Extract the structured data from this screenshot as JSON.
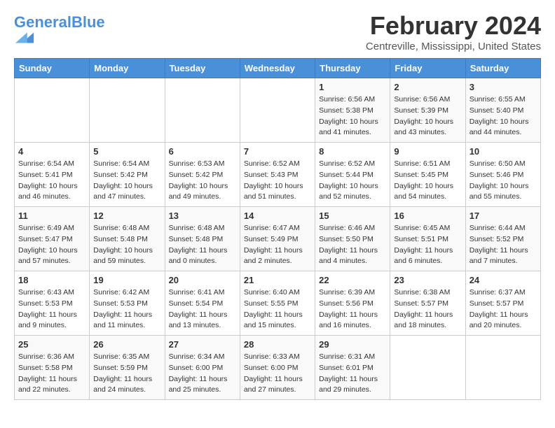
{
  "header": {
    "logo_text_general": "General",
    "logo_text_blue": "Blue",
    "month_year": "February 2024",
    "location": "Centreville, Mississippi, United States"
  },
  "days_of_week": [
    "Sunday",
    "Monday",
    "Tuesday",
    "Wednesday",
    "Thursday",
    "Friday",
    "Saturday"
  ],
  "weeks": [
    [
      {
        "day": "",
        "sunrise": "",
        "sunset": "",
        "daylight": ""
      },
      {
        "day": "",
        "sunrise": "",
        "sunset": "",
        "daylight": ""
      },
      {
        "day": "",
        "sunrise": "",
        "sunset": "",
        "daylight": ""
      },
      {
        "day": "",
        "sunrise": "",
        "sunset": "",
        "daylight": ""
      },
      {
        "day": "1",
        "sunrise": "Sunrise: 6:56 AM",
        "sunset": "Sunset: 5:38 PM",
        "daylight": "Daylight: 10 hours and 41 minutes."
      },
      {
        "day": "2",
        "sunrise": "Sunrise: 6:56 AM",
        "sunset": "Sunset: 5:39 PM",
        "daylight": "Daylight: 10 hours and 43 minutes."
      },
      {
        "day": "3",
        "sunrise": "Sunrise: 6:55 AM",
        "sunset": "Sunset: 5:40 PM",
        "daylight": "Daylight: 10 hours and 44 minutes."
      }
    ],
    [
      {
        "day": "4",
        "sunrise": "Sunrise: 6:54 AM",
        "sunset": "Sunset: 5:41 PM",
        "daylight": "Daylight: 10 hours and 46 minutes."
      },
      {
        "day": "5",
        "sunrise": "Sunrise: 6:54 AM",
        "sunset": "Sunset: 5:42 PM",
        "daylight": "Daylight: 10 hours and 47 minutes."
      },
      {
        "day": "6",
        "sunrise": "Sunrise: 6:53 AM",
        "sunset": "Sunset: 5:42 PM",
        "daylight": "Daylight: 10 hours and 49 minutes."
      },
      {
        "day": "7",
        "sunrise": "Sunrise: 6:52 AM",
        "sunset": "Sunset: 5:43 PM",
        "daylight": "Daylight: 10 hours and 51 minutes."
      },
      {
        "day": "8",
        "sunrise": "Sunrise: 6:52 AM",
        "sunset": "Sunset: 5:44 PM",
        "daylight": "Daylight: 10 hours and 52 minutes."
      },
      {
        "day": "9",
        "sunrise": "Sunrise: 6:51 AM",
        "sunset": "Sunset: 5:45 PM",
        "daylight": "Daylight: 10 hours and 54 minutes."
      },
      {
        "day": "10",
        "sunrise": "Sunrise: 6:50 AM",
        "sunset": "Sunset: 5:46 PM",
        "daylight": "Daylight: 10 hours and 55 minutes."
      }
    ],
    [
      {
        "day": "11",
        "sunrise": "Sunrise: 6:49 AM",
        "sunset": "Sunset: 5:47 PM",
        "daylight": "Daylight: 10 hours and 57 minutes."
      },
      {
        "day": "12",
        "sunrise": "Sunrise: 6:48 AM",
        "sunset": "Sunset: 5:48 PM",
        "daylight": "Daylight: 10 hours and 59 minutes."
      },
      {
        "day": "13",
        "sunrise": "Sunrise: 6:48 AM",
        "sunset": "Sunset: 5:48 PM",
        "daylight": "Daylight: 11 hours and 0 minutes."
      },
      {
        "day": "14",
        "sunrise": "Sunrise: 6:47 AM",
        "sunset": "Sunset: 5:49 PM",
        "daylight": "Daylight: 11 hours and 2 minutes."
      },
      {
        "day": "15",
        "sunrise": "Sunrise: 6:46 AM",
        "sunset": "Sunset: 5:50 PM",
        "daylight": "Daylight: 11 hours and 4 minutes."
      },
      {
        "day": "16",
        "sunrise": "Sunrise: 6:45 AM",
        "sunset": "Sunset: 5:51 PM",
        "daylight": "Daylight: 11 hours and 6 minutes."
      },
      {
        "day": "17",
        "sunrise": "Sunrise: 6:44 AM",
        "sunset": "Sunset: 5:52 PM",
        "daylight": "Daylight: 11 hours and 7 minutes."
      }
    ],
    [
      {
        "day": "18",
        "sunrise": "Sunrise: 6:43 AM",
        "sunset": "Sunset: 5:53 PM",
        "daylight": "Daylight: 11 hours and 9 minutes."
      },
      {
        "day": "19",
        "sunrise": "Sunrise: 6:42 AM",
        "sunset": "Sunset: 5:53 PM",
        "daylight": "Daylight: 11 hours and 11 minutes."
      },
      {
        "day": "20",
        "sunrise": "Sunrise: 6:41 AM",
        "sunset": "Sunset: 5:54 PM",
        "daylight": "Daylight: 11 hours and 13 minutes."
      },
      {
        "day": "21",
        "sunrise": "Sunrise: 6:40 AM",
        "sunset": "Sunset: 5:55 PM",
        "daylight": "Daylight: 11 hours and 15 minutes."
      },
      {
        "day": "22",
        "sunrise": "Sunrise: 6:39 AM",
        "sunset": "Sunset: 5:56 PM",
        "daylight": "Daylight: 11 hours and 16 minutes."
      },
      {
        "day": "23",
        "sunrise": "Sunrise: 6:38 AM",
        "sunset": "Sunset: 5:57 PM",
        "daylight": "Daylight: 11 hours and 18 minutes."
      },
      {
        "day": "24",
        "sunrise": "Sunrise: 6:37 AM",
        "sunset": "Sunset: 5:57 PM",
        "daylight": "Daylight: 11 hours and 20 minutes."
      }
    ],
    [
      {
        "day": "25",
        "sunrise": "Sunrise: 6:36 AM",
        "sunset": "Sunset: 5:58 PM",
        "daylight": "Daylight: 11 hours and 22 minutes."
      },
      {
        "day": "26",
        "sunrise": "Sunrise: 6:35 AM",
        "sunset": "Sunset: 5:59 PM",
        "daylight": "Daylight: 11 hours and 24 minutes."
      },
      {
        "day": "27",
        "sunrise": "Sunrise: 6:34 AM",
        "sunset": "Sunset: 6:00 PM",
        "daylight": "Daylight: 11 hours and 25 minutes."
      },
      {
        "day": "28",
        "sunrise": "Sunrise: 6:33 AM",
        "sunset": "Sunset: 6:00 PM",
        "daylight": "Daylight: 11 hours and 27 minutes."
      },
      {
        "day": "29",
        "sunrise": "Sunrise: 6:31 AM",
        "sunset": "Sunset: 6:01 PM",
        "daylight": "Daylight: 11 hours and 29 minutes."
      },
      {
        "day": "",
        "sunrise": "",
        "sunset": "",
        "daylight": ""
      },
      {
        "day": "",
        "sunrise": "",
        "sunset": "",
        "daylight": ""
      }
    ]
  ]
}
